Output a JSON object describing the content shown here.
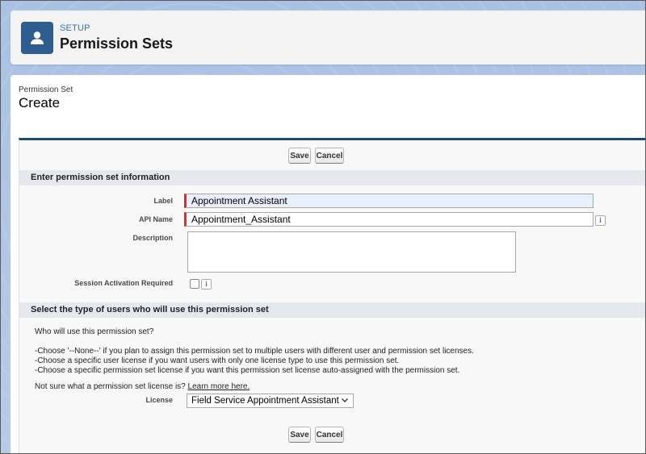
{
  "header": {
    "eyebrow": "SETUP",
    "title": "Permission Sets",
    "icon": "user-icon"
  },
  "page": {
    "eyebrow": "Permission Set",
    "title": "Create"
  },
  "buttons": {
    "save": "Save",
    "cancel": "Cancel"
  },
  "section1": {
    "title": "Enter permission set information",
    "fields": {
      "label": {
        "label": "Label",
        "value": "Appointment Assistant"
      },
      "api_name": {
        "label": "API Name",
        "value": "Appointment_Assistant"
      },
      "description": {
        "label": "Description",
        "value": ""
      },
      "session": {
        "label": "Session Activation Required",
        "checked": false
      }
    }
  },
  "section2": {
    "title": "Select the type of users who will use this permission set",
    "question": "Who will use this permission set?",
    "instructions": [
      "-Choose '--None--' if you plan to assign this permission set to multiple users with different user and permission set licenses.",
      "-Choose a specific user license if you want users with only one license type to use this permission set.",
      "-Choose a specific permission set license if you want this permission set license auto-assigned with the permission set."
    ],
    "not_sure": "Not sure what a permission set license is?",
    "learn_more": "Learn more here.",
    "license_label": "License",
    "license_value": "Field Service Appointment Assistant"
  },
  "colors": {
    "accent": "#1b4a73",
    "header_icon_bg": "#2e5e90",
    "required_bar": "#c23934"
  }
}
